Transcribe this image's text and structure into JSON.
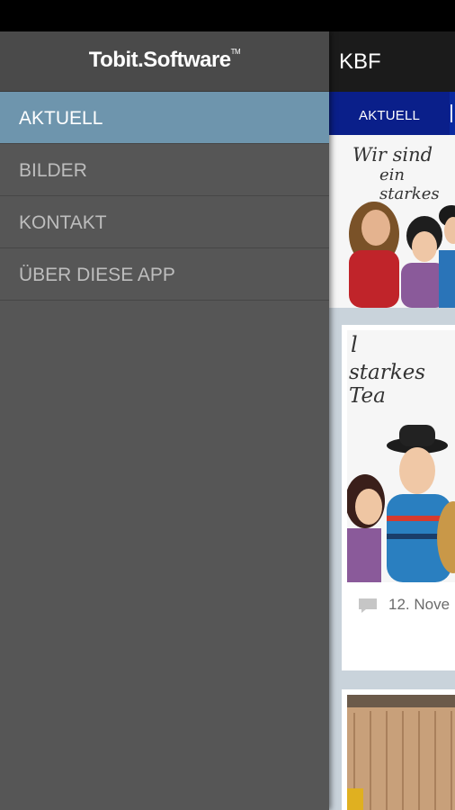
{
  "app": {
    "title": "KBF"
  },
  "drawer": {
    "logo_text": "Tobit.Software",
    "logo_tm": "TM",
    "items": [
      {
        "label": "AKTUELL",
        "active": true
      },
      {
        "label": "BILDER",
        "active": false
      },
      {
        "label": "KONTAKT",
        "active": false
      },
      {
        "label": "ÜBER DIESE APP",
        "active": false
      }
    ]
  },
  "tabs": [
    {
      "label": "AKTUELL",
      "active": true
    }
  ],
  "feed": {
    "card1_handwriting_line1": "Wir sind",
    "card1_handwriting_line2": "ein starkes",
    "card2_handwriting_line1": "l",
    "card2_handwriting_line2": "starkes Tea",
    "card2_date": "12. Nove"
  },
  "colors": {
    "drawer_bg": "#565656",
    "active_item": "#6e95ad",
    "tab_bar": "#0a1f8a",
    "app_bar": "#1b1b1b"
  }
}
